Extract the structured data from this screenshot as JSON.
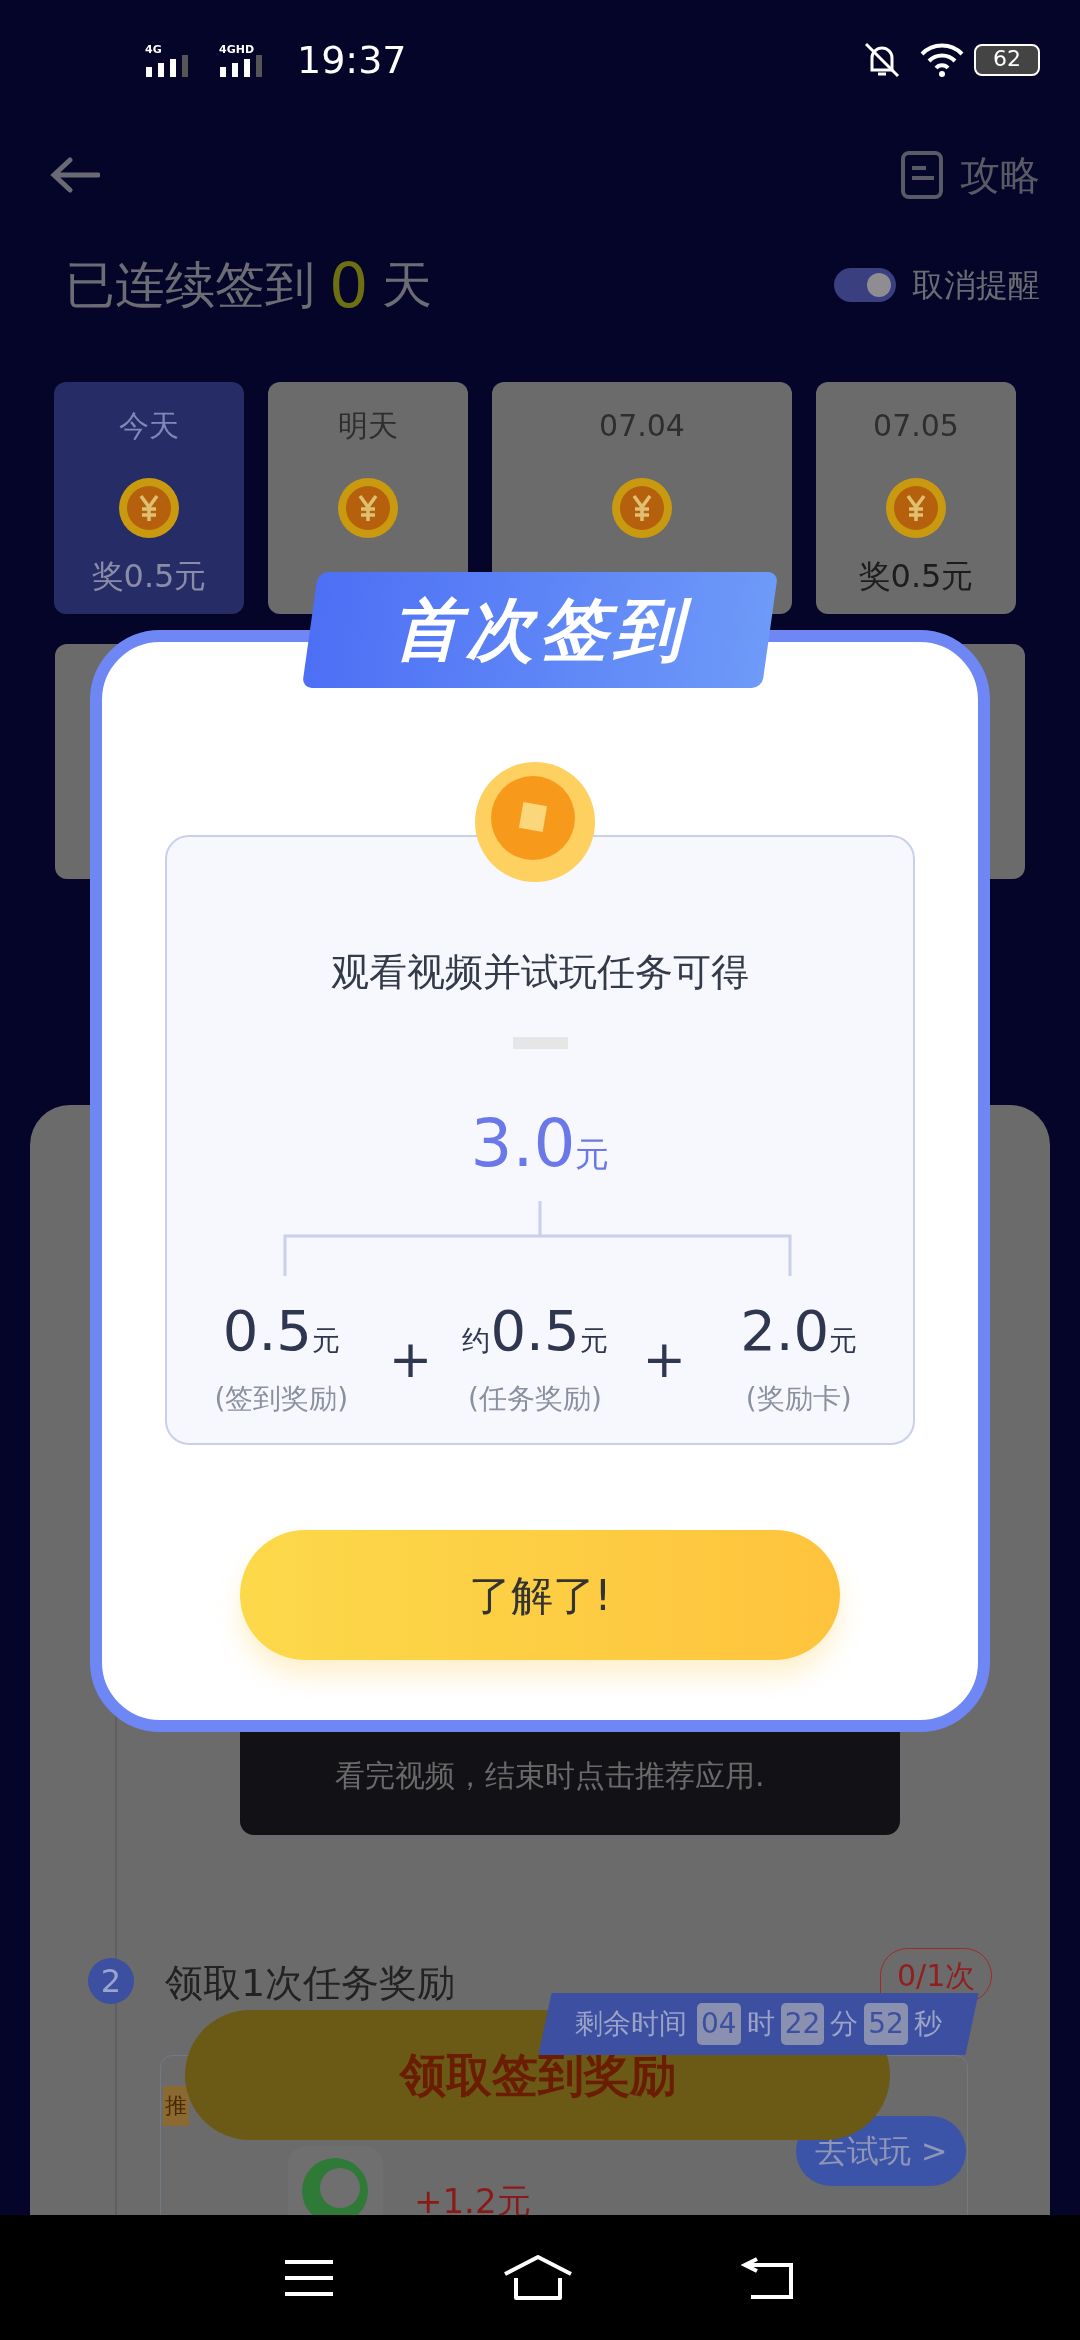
{
  "status_bar": {
    "sim1": "4G",
    "sim2": "4GHD",
    "time": "19:37",
    "battery": "62"
  },
  "header": {
    "guide": "攻略"
  },
  "streak": {
    "prefix": "已连续签到",
    "days": "0",
    "suffix": "天",
    "reminder": {
      "label": "取消提醒",
      "on": true
    }
  },
  "days": [
    {
      "label": "今天",
      "reward": "奖0.5元",
      "selected": true
    },
    {
      "label": "明天",
      "selected": false
    },
    {
      "label": "07.04",
      "selected": false
    },
    {
      "label": "07.05",
      "reward": "奖0.5元",
      "selected": false
    }
  ],
  "video_caption": "看完视频，结束时点击推荐应用.",
  "step": {
    "number": "2",
    "title": "领取1次任务奖励",
    "progress": "0/1次"
  },
  "app_offer": {
    "ribbon": "推",
    "reward": "+1.2元",
    "button": "去试玩 >"
  },
  "claim_button": "领取签到奖励",
  "countdown": {
    "label": "剩余时间",
    "parts": [
      {
        "value": "04",
        "unit": "时"
      },
      {
        "value": "22",
        "unit": "分"
      },
      {
        "value": "52",
        "unit": "秒"
      }
    ]
  },
  "dialog": {
    "banner": "首次签到",
    "subtitle": "观看视频并试玩任务可得",
    "total": {
      "amount": "3.0",
      "unit": "元"
    },
    "parts": [
      {
        "amount": "0.5",
        "unit": "元",
        "label": "(签到奖励)"
      },
      {
        "operator": "+",
        "prefix": "约",
        "amount": "0.5",
        "unit": "元",
        "label": "(任务奖励)"
      },
      {
        "operator": "+",
        "amount": "2.0",
        "unit": "元",
        "label": "(奖励卡)"
      }
    ],
    "button": "了解了!"
  }
}
